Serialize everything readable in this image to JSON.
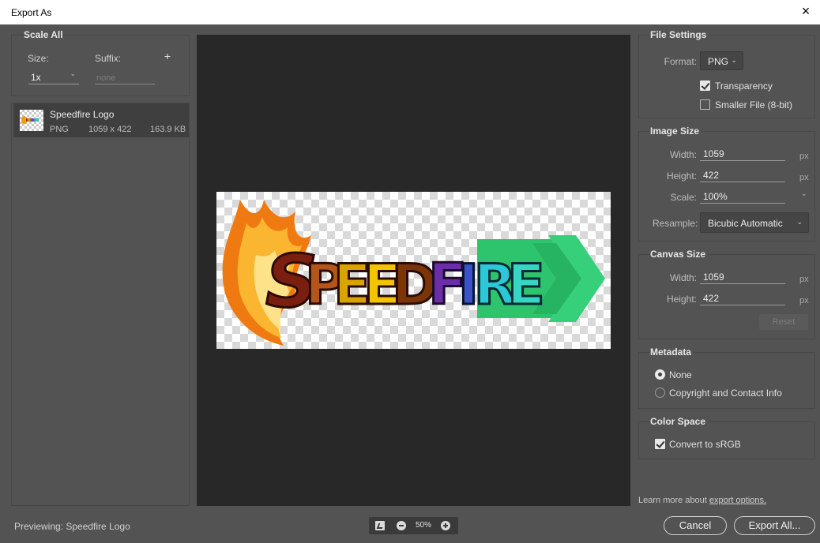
{
  "window": {
    "title": "Export As",
    "close_icon": "×"
  },
  "left": {
    "scale_all_label": "Scale All",
    "size_label": "Size:",
    "suffix_label": "Suffix:",
    "add_icon": "+",
    "size_value": "1x",
    "suffix_placeholder": "none",
    "assets": [
      {
        "name": "Speedfire Logo",
        "type": "PNG",
        "dimensions": "1059 x 422",
        "file_size": "163.9 KB"
      }
    ]
  },
  "preview": {
    "zoom_value": "50%",
    "previewing_text": "Previewing: Speedfire Logo",
    "logo_text": "SPEEDFIRE"
  },
  "file_settings": {
    "header": "File Settings",
    "format_label": "Format:",
    "format_value": "PNG",
    "transparency_label": "Transparency",
    "transparency_checked": true,
    "smaller_file_label": "Smaller File (8-bit)",
    "smaller_file_checked": false
  },
  "image_size": {
    "header": "Image Size",
    "width_label": "Width:",
    "width_value": "1059",
    "height_label": "Height:",
    "height_value": "422",
    "scale_label": "Scale:",
    "scale_value": "100%",
    "resample_label": "Resample:",
    "resample_value": "Bicubic Automatic",
    "unit": "px"
  },
  "canvas_size": {
    "header": "Canvas Size",
    "width_label": "Width:",
    "width_value": "1059",
    "height_label": "Height:",
    "height_value": "422",
    "unit": "px",
    "reset_label": "Reset"
  },
  "metadata": {
    "header": "Metadata",
    "options": [
      "None",
      "Copyright and Contact Info"
    ],
    "selected": "None"
  },
  "color_space": {
    "header": "Color Space",
    "convert_label": "Convert to sRGB",
    "convert_checked": true
  },
  "footer": {
    "learn_prefix": "Learn more about",
    "learn_link": "export options.",
    "cancel_label": "Cancel",
    "export_label": "Export All..."
  },
  "colors": {
    "panel_bg": "#535353",
    "preview_bg": "#282828",
    "title_bar": "#ffffff"
  }
}
